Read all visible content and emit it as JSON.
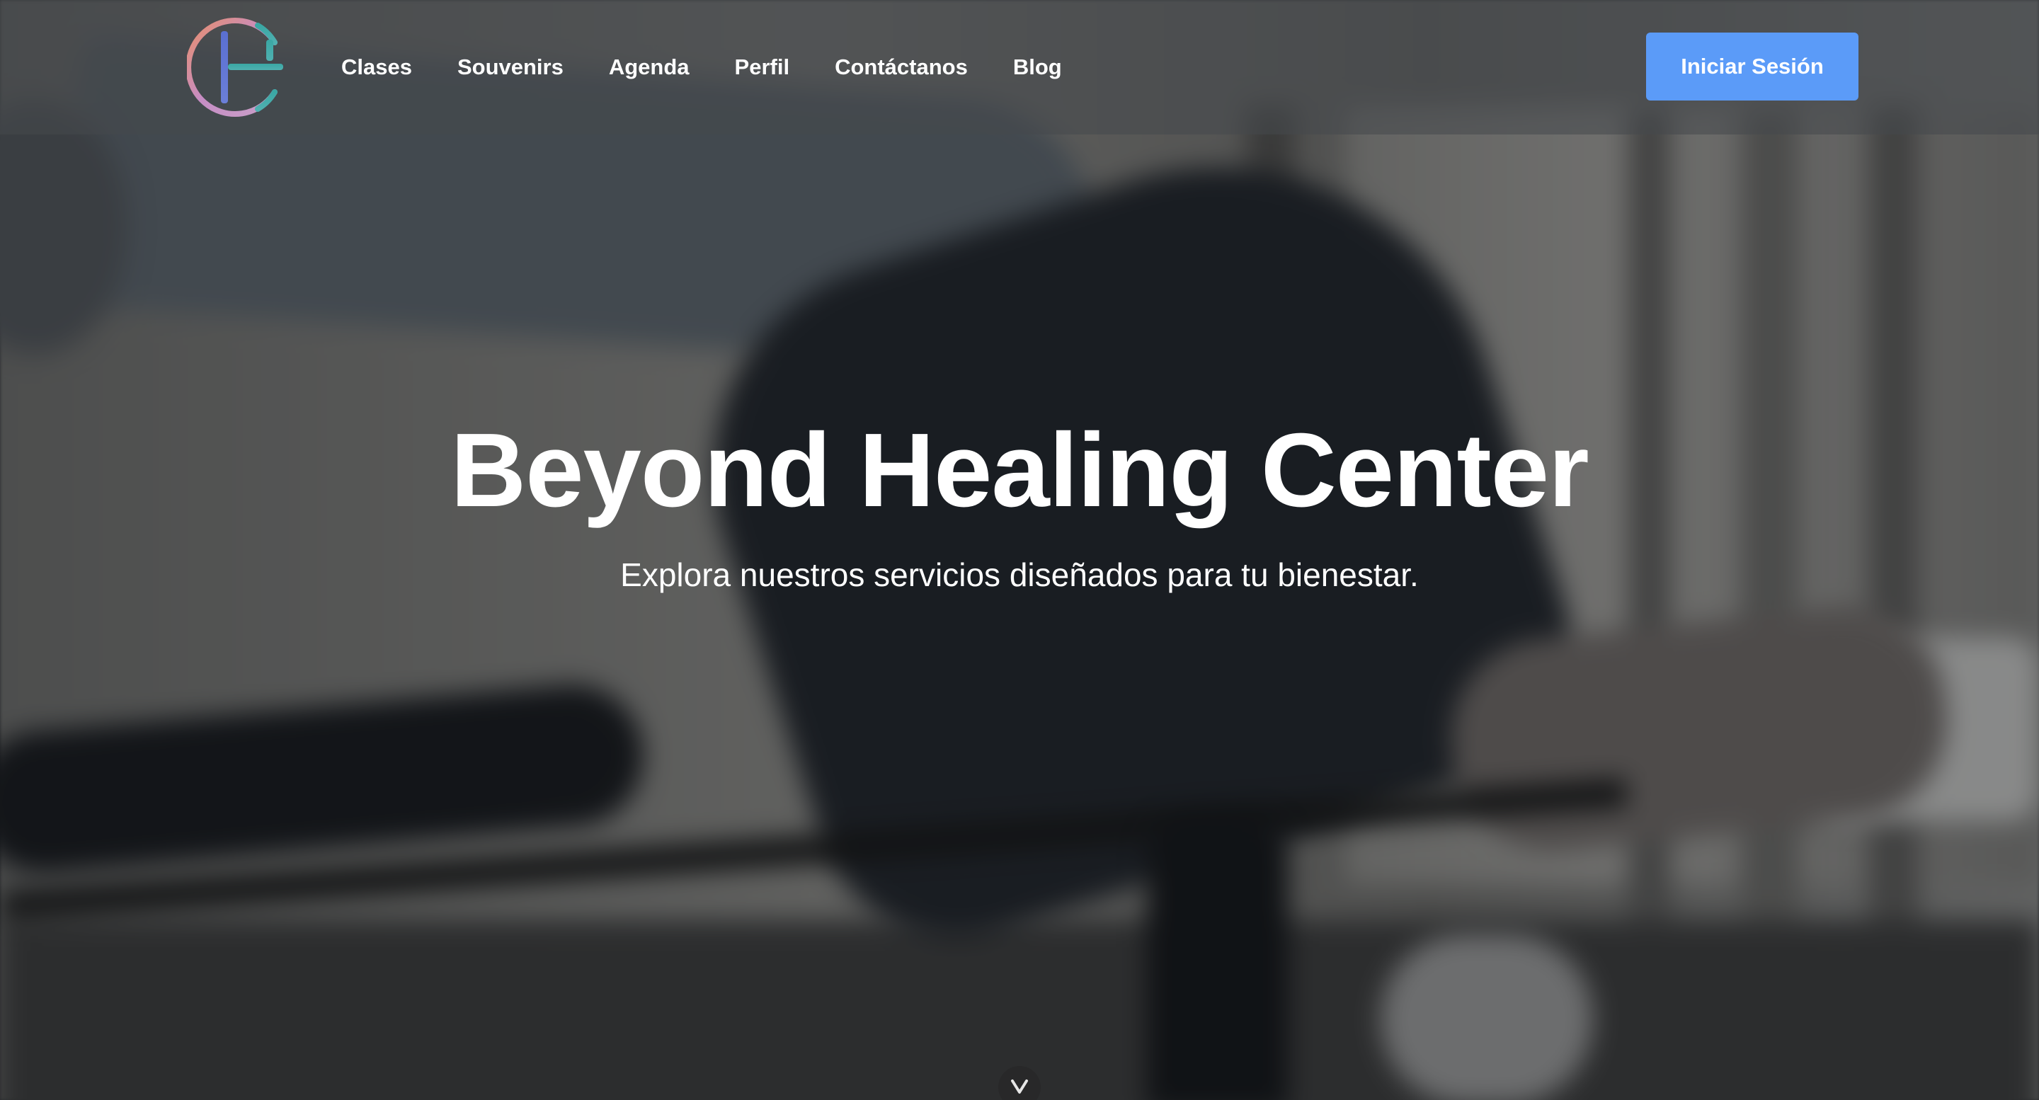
{
  "brand": {
    "logo_name": "Beyond Healing Center logo",
    "colors": {
      "ring_start": "#e88e6a",
      "ring_mid": "#c68dc5",
      "ring_end": "#3aa7a4",
      "bar": "#5a6fd0"
    }
  },
  "nav": {
    "items": [
      {
        "label": "Clases"
      },
      {
        "label": "Souvenirs"
      },
      {
        "label": "Agenda"
      },
      {
        "label": "Perfil"
      },
      {
        "label": "Contáctanos"
      },
      {
        "label": "Blog"
      }
    ],
    "login_label": "Iniciar Sesión",
    "login_color": "#5b9bf8"
  },
  "hero": {
    "title": "Beyond Healing Center",
    "subtitle": "Explora nuestros servicios diseñados para tu bienestar.",
    "scroll_icon": "chevron-down-icon"
  }
}
